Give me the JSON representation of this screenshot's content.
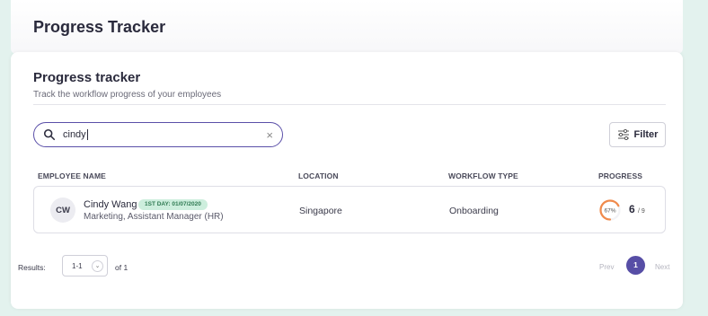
{
  "app": {
    "title": "Progress Tracker"
  },
  "section": {
    "title": "Progress tracker",
    "subtitle": "Track the workflow progress of your employees"
  },
  "search": {
    "value": "cindy",
    "clear_icon": "close-icon"
  },
  "filter": {
    "label": "Filter",
    "icon": "sliders-icon"
  },
  "table": {
    "columns": [
      "EMPLOYEE NAME",
      "LOCATION",
      "WORKFLOW TYPE",
      "PROGRESS"
    ],
    "rows": [
      {
        "initials": "CW",
        "name": "Cindy Wang",
        "badge": "1ST DAY: 01/07/2020",
        "role": "Marketing, Assistant Manager (HR)",
        "location": "Singapore",
        "workflow": "Onboarding",
        "progress_pct_label": "67%",
        "progress_fraction": 0.67,
        "progress_done": "6",
        "progress_total": "/ 9"
      }
    ]
  },
  "pagination": {
    "results_label": "Results:",
    "range": "1-1",
    "of_label": "of 1",
    "prev": "Prev",
    "current_page": "1",
    "next": "Next"
  },
  "colors": {
    "page_bg": "#e3f2ee",
    "accent": "#574ea6",
    "progress_ring": "#f08a4b",
    "badge_bg": "#cdeedd",
    "badge_text": "#2f7a52"
  }
}
